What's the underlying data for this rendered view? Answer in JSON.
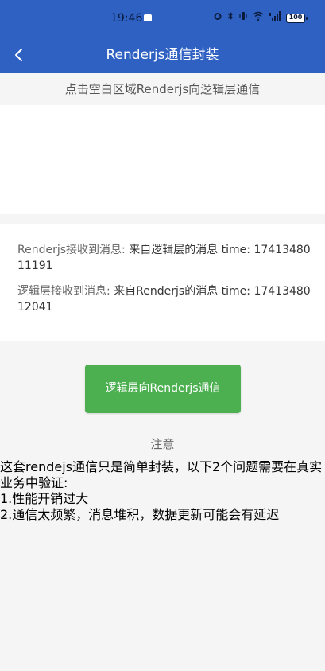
{
  "status_bar": {
    "time": "19:46",
    "battery": "100"
  },
  "nav": {
    "title": "Renderjs通信封装"
  },
  "hint": {
    "text": "点击空白区域Renderjs向逻辑层通信"
  },
  "messages": [
    {
      "label": "Renderjs接收到消息:",
      "value": " 来自逻辑层的消息 time: 1741348011191"
    },
    {
      "label": "逻辑层接收到消息:",
      "value": " 来自Renderjs的消息 time: 1741348012041"
    }
  ],
  "action_button": {
    "label": "逻辑层向Renderjs通信",
    "color": "#4CAF50"
  },
  "note": {
    "title": "注意",
    "lines": [
      "这套rendejs通信只是简单封装，以下2个问题需要在真实业务中验证:",
      "1.性能开销过大",
      "2.通信太频繁，消息堆积，数据更新可能会有延迟"
    ]
  },
  "colors": {
    "header": "#2F61C3",
    "background": "#f5f5f5"
  },
  "icons": {
    "back": "chevron-left-icon",
    "status": [
      "notification-dot-icon",
      "alarm-icon",
      "bluetooth-icon",
      "vibrate-icon",
      "wifi-icon",
      "signal-icon",
      "battery-icon"
    ]
  }
}
